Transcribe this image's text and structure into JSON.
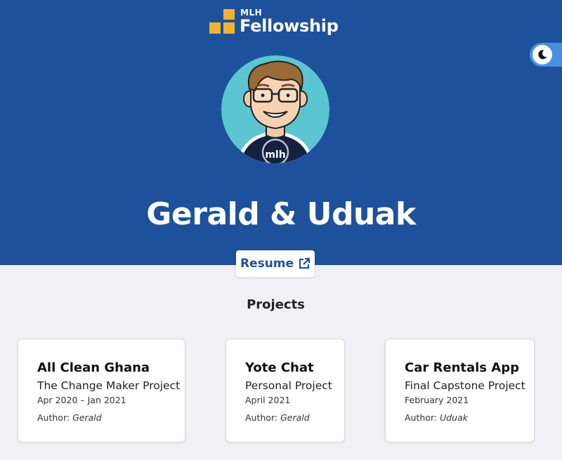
{
  "brand": {
    "small": "MLH",
    "big": "Fellowship",
    "accent": "#f0b331",
    "hero_bg": "#1e519c"
  },
  "theme_toggle": {
    "icon": "moon-icon"
  },
  "profile": {
    "avatar_icon": "avatar-illustration",
    "name": "Gerald & Uduak"
  },
  "resume": {
    "label": "Resume",
    "icon": "external-link-icon"
  },
  "projects": {
    "heading": "Projects",
    "items": [
      {
        "title": "All Clean Ghana",
        "subtitle": "The Change Maker Project",
        "date": "Apr 2020 – Jan 2021",
        "author_label": "Author:",
        "author": "Gerald"
      },
      {
        "title": "Yote Chat",
        "subtitle": "Personal Project",
        "date": "April 2021",
        "author_label": "Author:",
        "author": "Gerald"
      },
      {
        "title": "Car Rentals App",
        "subtitle": "Final Capstone Project",
        "date": "February 2021",
        "author_label": "Author:",
        "author": "Uduak"
      }
    ]
  }
}
